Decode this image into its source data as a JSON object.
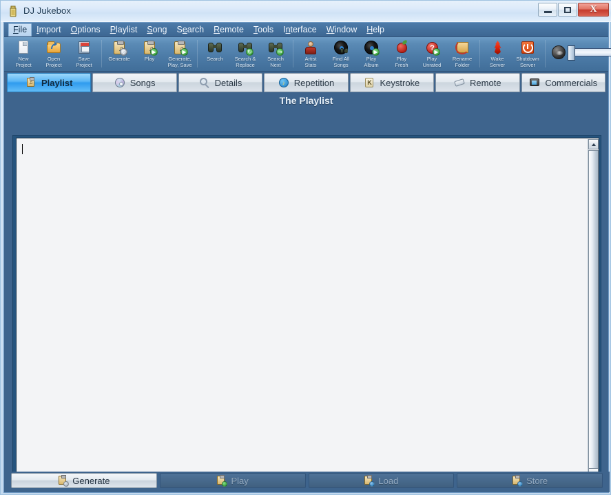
{
  "window": {
    "title": "DJ Jukebox",
    "icon": "jukebox-icon",
    "controls": {
      "minimize": "minimize-button",
      "maximize": "maximize-button",
      "close_glyph": "X"
    }
  },
  "menubar": {
    "items": [
      {
        "label": "File",
        "accel": "F",
        "active": true
      },
      {
        "label": "Import",
        "accel": "I",
        "active": false
      },
      {
        "label": "Options",
        "accel": "O",
        "active": false
      },
      {
        "label": "Playlist",
        "accel": "P",
        "active": false
      },
      {
        "label": "Song",
        "accel": "S",
        "active": false
      },
      {
        "label": "Search",
        "accel": "e",
        "active": false
      },
      {
        "label": "Remote",
        "accel": "R",
        "active": false
      },
      {
        "label": "Tools",
        "accel": "T",
        "active": false
      },
      {
        "label": "Interface",
        "accel": "n",
        "active": false
      },
      {
        "label": "Window",
        "accel": "W",
        "active": false
      },
      {
        "label": "Help",
        "accel": "H",
        "active": false
      }
    ]
  },
  "toolbar": {
    "buttons": [
      {
        "line1": "New",
        "line2": "Project",
        "icon": "new-document-icon"
      },
      {
        "line1": "Open",
        "line2": "Project",
        "icon": "open-folder-icon"
      },
      {
        "line1": "Save",
        "line2": "Project",
        "icon": "floppy-disk-icon"
      },
      {
        "separator": true
      },
      {
        "line1": "Generate",
        "line2": "",
        "icon": "clipboard-gear-icon"
      },
      {
        "line1": "Play",
        "line2": "",
        "icon": "clipboard-play-icon"
      },
      {
        "line1": "Generate,",
        "line2": "Play, Save",
        "icon": "clipboard-generate-play-save-icon"
      },
      {
        "separator": true
      },
      {
        "line1": "Search",
        "line2": "",
        "icon": "binoculars-icon"
      },
      {
        "line1": "Search &",
        "line2": "Replace",
        "icon": "binoculars-replace-icon"
      },
      {
        "line1": "Search",
        "line2": "Next",
        "icon": "binoculars-next-icon"
      },
      {
        "separator": true
      },
      {
        "line1": "Artist",
        "line2": "Stats",
        "icon": "artist-person-icon"
      },
      {
        "line1": "Find All",
        "line2": "Songs",
        "icon": "vinyl-find-icon"
      },
      {
        "line1": "Play",
        "line2": "Album",
        "icon": "vinyl-play-icon"
      },
      {
        "line1": "Play",
        "line2": "Fresh",
        "icon": "apple-icon"
      },
      {
        "line1": "Play",
        "line2": "Unrated",
        "icon": "question-mark-icon"
      },
      {
        "line1": "Rename",
        "line2": "Folder",
        "icon": "rename-folder-icon"
      },
      {
        "separator": true
      },
      {
        "line1": "Wake",
        "line2": "Server",
        "icon": "flame-wake-icon"
      },
      {
        "line1": "Shutdown",
        "line2": "Server",
        "icon": "power-shutdown-icon"
      }
    ],
    "volume": {
      "speaker_icon": "speaker-icon",
      "slider_name": "volume-slider",
      "value": 0
    }
  },
  "tabs": [
    {
      "label": "Playlist",
      "icon": "clipboard-note-icon",
      "active": true
    },
    {
      "label": "Songs",
      "icon": "cd-disc-icon",
      "active": false
    },
    {
      "label": "Details",
      "icon": "magnifier-icon",
      "active": false
    },
    {
      "label": "Repetition",
      "icon": "repeat-circle-icon",
      "active": false
    },
    {
      "label": "Keystroke",
      "icon": "key-cap-icon",
      "active": false
    },
    {
      "label": "Remote",
      "icon": "remote-control-icon",
      "active": false
    },
    {
      "label": "Commercials",
      "icon": "television-icon",
      "active": false
    }
  ],
  "page": {
    "title": "The Playlist"
  },
  "editor": {
    "value": "",
    "placeholder": ""
  },
  "scrollbars": {
    "vertical": {
      "up": "scroll-up",
      "down": "scroll-down"
    },
    "horizontal": {
      "left": "scroll-left",
      "right": "scroll-right",
      "grip": "‖"
    }
  },
  "actions": [
    {
      "label": "Generate",
      "icon": "clipboard-gear-icon",
      "enabled": true
    },
    {
      "label": "Play",
      "icon": "clipboard-play-icon",
      "enabled": false
    },
    {
      "label": "Load",
      "icon": "clipboard-load-icon",
      "enabled": false
    },
    {
      "label": "Store",
      "icon": "clipboard-store-icon",
      "enabled": false
    }
  ],
  "colors": {
    "window_body": "#3e648d",
    "titlebar": "#dceafa",
    "menubar": "#44709d",
    "toolbar": "#4b7aa6",
    "tab_active": "#2f9bee",
    "editor_bg": "#f3f4f6",
    "close_button": "#c5392c"
  }
}
